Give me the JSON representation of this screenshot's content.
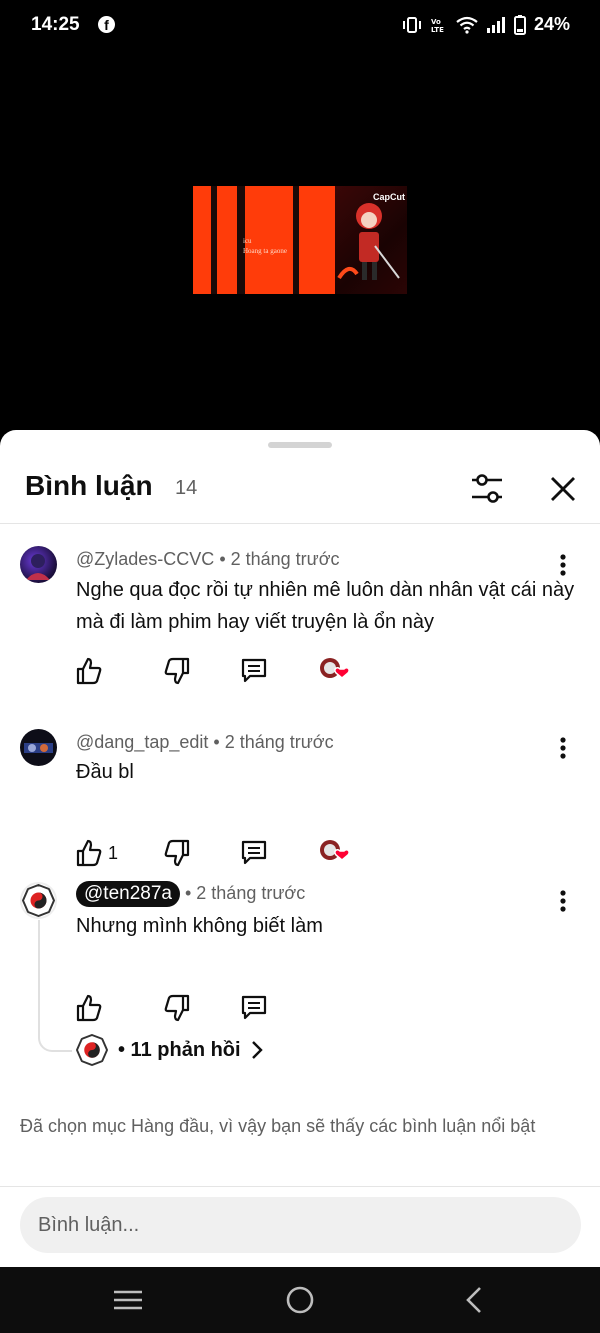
{
  "status_bar": {
    "time": "14:25",
    "notification_icon": "facebook-icon",
    "battery": "24%",
    "icons": [
      "vibrate-icon",
      "volte-icon",
      "wifi-icon",
      "signal-icon",
      "battery-icon"
    ]
  },
  "video": {
    "thumbnail_brand": "CapCut",
    "thumbnail_caption_line1": "icu",
    "thumbnail_caption_line2": "Hoang ta gaone"
  },
  "sheet": {
    "title": "Bình luận",
    "count": "14"
  },
  "comments": [
    {
      "author": "@Zylades-CCVC",
      "time": "• 2 tháng trước",
      "text": "Nghe qua đọc rồi tự nhiên mê luôn dàn nhân vật cái này mà đi làm phim hay viết truyện là ổn này",
      "likes": "",
      "creator_heart": true
    },
    {
      "author": "@dang_tap_edit",
      "time": "• 2 tháng trước",
      "text": "Đầu bl",
      "likes": "1",
      "creator_heart": true
    },
    {
      "author": "@ten287a",
      "time": "• 2 tháng trước",
      "text": "Nhưng mình không biết làm",
      "likes": "",
      "creator_heart": false,
      "replies_label": "• 11 phản hồi"
    }
  ],
  "footnote": "Đã chọn mục Hàng đầu, vì vậy bạn sẽ thấy các bình luận nổi bật",
  "input": {
    "placeholder": "Bình luận..."
  },
  "colors": {
    "accent_red": "#ff0033",
    "thumbnail_orange": "#ff3c0a",
    "text_primary": "#0f0f0f",
    "text_secondary": "#606060",
    "input_bg": "#f0f0f0"
  }
}
